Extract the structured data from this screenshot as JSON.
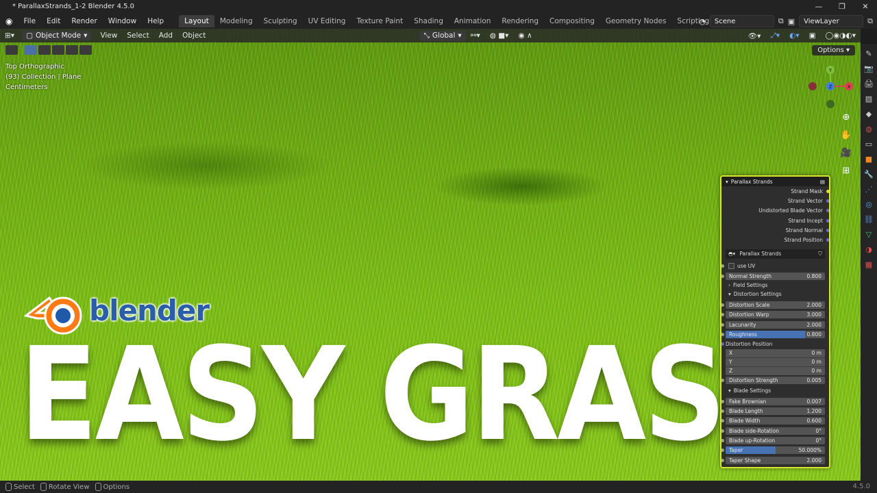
{
  "window": {
    "title": "* ParallaxStrands_1-2 Blender 4.5.0"
  },
  "menu": [
    "File",
    "Edit",
    "Render",
    "Window",
    "Help"
  ],
  "workspaces": [
    "Layout",
    "Modeling",
    "Sculpting",
    "UV Editing",
    "Texture Paint",
    "Shading",
    "Animation",
    "Rendering",
    "Compositing",
    "Geometry Nodes",
    "Scripting"
  ],
  "scene": {
    "name": "Scene",
    "view_layer": "ViewLayer"
  },
  "viewport_header": {
    "mode": "Object Mode",
    "menus": [
      "View",
      "Select",
      "Add",
      "Object"
    ],
    "orientation": "Global",
    "options_label": "Options"
  },
  "viewport_info": {
    "view": "Top Orthographic",
    "collection": "(93) Collection | Plane",
    "units": "Centimeters"
  },
  "gizmo": {
    "y": "Y",
    "z": "Z",
    "x": "X"
  },
  "overlay": {
    "brand": "blender",
    "headline": "EASY GRASS"
  },
  "node": {
    "title": "Parallax Strands",
    "outputs": [
      "Strand Mask",
      "Strand Vector",
      "Undistorted Blade Vector",
      "Strand Incept",
      "Strand Normal",
      "Strand Position"
    ],
    "group_name": "Parallax Strands",
    "use_uv": "use UV",
    "normal_strength": {
      "label": "Normal Strength",
      "value": "0.800"
    },
    "field_settings": "Field Settings",
    "distortion_settings": "Distortion Settings",
    "distortion": [
      {
        "label": "Distortion Scale",
        "value": "2.000"
      },
      {
        "label": "Distortion Warp",
        "value": "3.000"
      },
      {
        "label": "Lacunarity",
        "value": "2.000"
      },
      {
        "label": "Roughness",
        "value": "0.800"
      }
    ],
    "distortion_position": {
      "label": "Distortion Position",
      "x": "X",
      "y": "Y",
      "z": "Z",
      "xv": "0 m",
      "yv": "0 m",
      "zv": "0 m"
    },
    "distortion_strength": {
      "label": "Distortion Strength",
      "value": "0.005"
    },
    "blade_settings": "Blade Settings",
    "blade": [
      {
        "label": "Fake Brownian",
        "value": "0.007"
      },
      {
        "label": "Blade Length",
        "value": "1.200"
      },
      {
        "label": "Blade Width",
        "value": "0.600"
      },
      {
        "label": "Blade side-Rotation",
        "value": "0°"
      },
      {
        "label": "Blade up-Rotation",
        "value": "0°"
      },
      {
        "label": "Taper",
        "value": "50.000%"
      },
      {
        "label": "Taper Shape",
        "value": "2.000"
      }
    ],
    "roughness_fill": 0.8,
    "taper_fill": 0.5
  },
  "statusbar": {
    "select": "Select",
    "rotate": "Rotate View",
    "options": "Options",
    "version": "4.5.0"
  }
}
